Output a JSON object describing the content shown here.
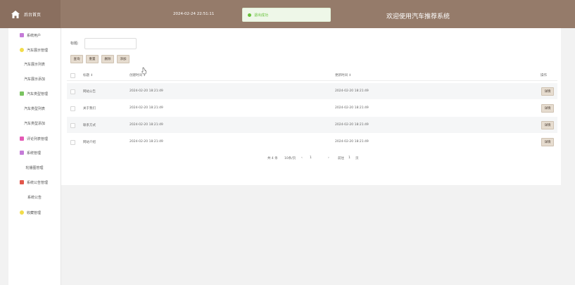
{
  "header": {
    "home_label": "后台首页",
    "datetime": "2024-02-24 22:51:11",
    "toast": "退出成功",
    "welcome": "欢迎使用汽车推荐系统"
  },
  "sidebar": {
    "items": [
      {
        "label": "系统用户",
        "icon": "user-icon"
      },
      {
        "label": "汽车展示管理",
        "icon": "circle-icon"
      },
      {
        "label": "汽车展示列表"
      },
      {
        "label": "汽车展示添加"
      },
      {
        "label": "汽车类型管理",
        "icon": "car-icon"
      },
      {
        "label": "汽车类型列表"
      },
      {
        "label": "汽车类型添加"
      },
      {
        "label": "评论列表管理",
        "icon": "comment-icon"
      },
      {
        "label": "系统管理",
        "icon": "gear-icon"
      },
      {
        "label": "轮播图管理"
      },
      {
        "label": "系统公告管理",
        "icon": "notice-icon"
      },
      {
        "label": "系统公告"
      },
      {
        "label": "收藏管理",
        "icon": "star-icon"
      }
    ]
  },
  "search": {
    "label": "标题:",
    "placeholder": ""
  },
  "toolbar": {
    "query": "查询",
    "reset": "重置",
    "delete": "删除",
    "add": "添加"
  },
  "table": {
    "headers": [
      "标题 ↕",
      "创建时间 ↕",
      "更新时间 ↕",
      "操作"
    ],
    "rows": [
      {
        "title": "网站公告",
        "created": "2024-02-20 18:21:49",
        "updated": "2024-02-20 18:21:49",
        "action": "详情"
      },
      {
        "title": "关于我们",
        "created": "2024-02-20 18:21:49",
        "updated": "2024-02-20 18:21:49",
        "action": "详情"
      },
      {
        "title": "联系方式",
        "created": "2024-02-20 18:21:49",
        "updated": "2024-02-20 18:21:49",
        "action": "详情"
      },
      {
        "title": "网站介绍",
        "created": "2024-02-20 18:21:49",
        "updated": "2024-02-20 18:21:49",
        "action": "详情"
      }
    ]
  },
  "pagination": {
    "total": "共 4 条",
    "page_size": "10条/页",
    "prev": "‹",
    "page": "1",
    "next": "›",
    "goto_label": "前往",
    "goto_value": "1",
    "page_suffix": "页"
  },
  "colors": {
    "header": "#957b6a",
    "button": "#e6dccf",
    "success": "#67c23a"
  }
}
